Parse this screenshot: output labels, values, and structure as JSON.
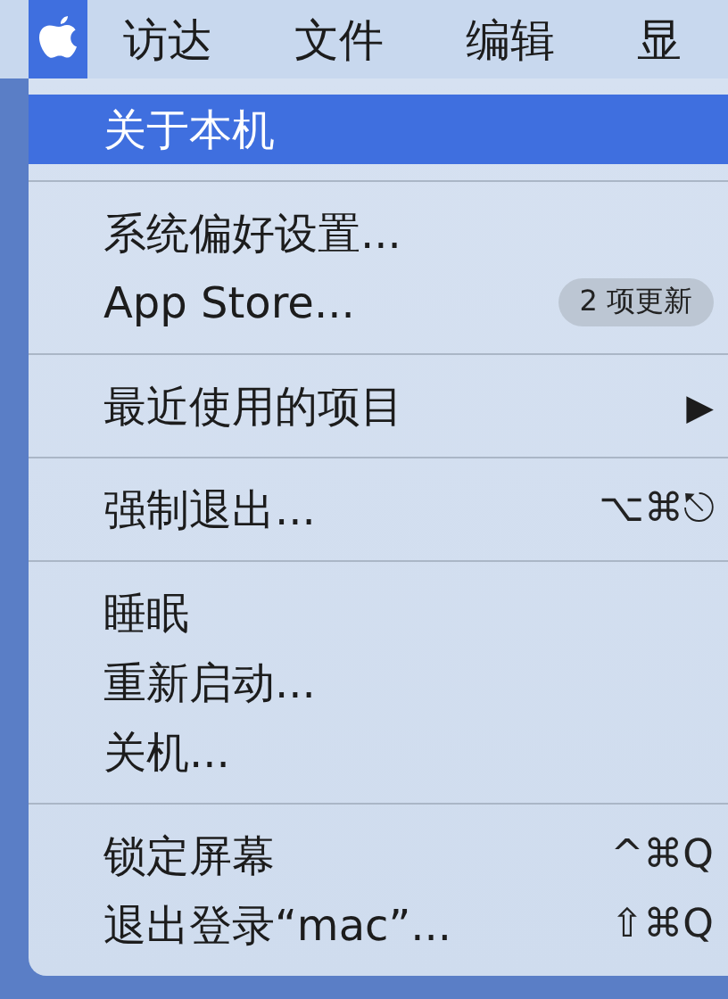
{
  "menu_bar": {
    "apple_menu_selected": true,
    "items": [
      {
        "label": "访达",
        "selected": false
      },
      {
        "label": "文件",
        "selected": false
      },
      {
        "label": "编辑",
        "selected": false
      },
      {
        "label": "显",
        "selected": false
      }
    ]
  },
  "menu": {
    "sections": [
      [
        {
          "label": "关于本机",
          "selected": true
        }
      ],
      [
        {
          "label": "系统偏好设置...",
          "selected": false
        },
        {
          "label": "App Store...",
          "badge": "2 项更新",
          "selected": false
        }
      ],
      [
        {
          "label": "最近使用的项目",
          "arrow": "▶",
          "selected": false
        }
      ],
      [
        {
          "label": "强制退出...",
          "shortcut": "⌥⌘⎋",
          "selected": false
        }
      ],
      [
        {
          "label": "睡眠",
          "selected": false
        },
        {
          "label": "重新启动...",
          "selected": false
        },
        {
          "label": "关机...",
          "selected": false
        }
      ],
      [
        {
          "label": "锁定屏幕",
          "shortcut": "^⌘Q",
          "selected": false
        },
        {
          "label": "退出登录“mac”...",
          "shortcut": "⇧⌘Q",
          "selected": false
        }
      ]
    ]
  }
}
